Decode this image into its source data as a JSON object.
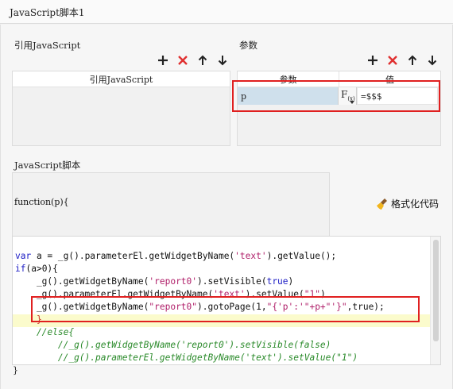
{
  "window": {
    "title": "JavaScript脚本1"
  },
  "left_section": {
    "title": "引用JavaScript",
    "table_header": "引用JavaScript"
  },
  "right_section": {
    "title": "参数",
    "col_param": "参数",
    "col_value": "值",
    "row": {
      "name": "p",
      "fx_label": "F",
      "fx_sub": "(x)",
      "value": "=$$$"
    }
  },
  "script_section": {
    "title": "JavaScript脚本",
    "function_header": "function(p){",
    "format_button": "格式化代码",
    "closing": "}"
  },
  "code": {
    "line1": "var a = _g().parameterEl.getWidgetByName('text').getValue();",
    "line2_kw": "if",
    "line2_rest": "(a>0){",
    "line3_a": "    _g().getWidgetByName(",
    "line3_str": "'report0'",
    "line3_b": ").setVisible(",
    "line3_kw": "true",
    "line3_c": ")",
    "line4_a": "    _g().parameterEl.getWidgetByName(",
    "line4_str": "'text'",
    "line4_b": ").setValue(",
    "line4_str2": "\"1\"",
    "line4_c": ")",
    "line5_a": "    _g().getWidgetByName(",
    "line5_str": "\"report0\"",
    "line5_b": ").gotoPage(1,",
    "line5_str2": "\"{'p':'\"+p+\"'}\"",
    "line5_c": ",true);",
    "line6": "    }",
    "line7": "    //else{",
    "line8": "        //_g().getWidgetByName('report0').setVisible(false)",
    "line9": "        //_g().parameterEl.getWidgetByName('text').setValue(\"1\")"
  },
  "icons": {
    "add": "plus-icon",
    "delete": "cross-icon",
    "up": "arrow-up-icon",
    "down": "arrow-down-icon",
    "broom": "broom-icon"
  },
  "colors": {
    "highlight_red": "#e02020",
    "selected_cell": "#cfe0ec",
    "delete_red": "#e03030"
  }
}
